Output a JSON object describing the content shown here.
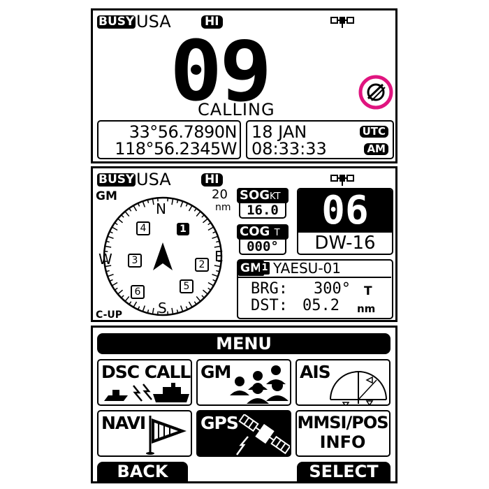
{
  "screen1": {
    "busy": "BUSY",
    "region": "USA",
    "power": "HI",
    "gps_icon": "gps-satellite-icon",
    "channel": "09",
    "status": "CALLING",
    "lat": "33°56.7890N",
    "lon": "118°56.2345W",
    "date": "18 JAN",
    "time": "08:33:33",
    "tz": "UTC",
    "ampm": "AM",
    "scramble_icon": "scramble-icon"
  },
  "screen2": {
    "busy": "BUSY",
    "region": "USA",
    "power": "HI",
    "mode": "GM",
    "range": "20",
    "range_unit": "nm",
    "orientation": "C-UP",
    "compass": {
      "n": "N",
      "s": "S",
      "e": "E",
      "w": "W"
    },
    "members": [
      "1",
      "2",
      "3",
      "4",
      "5",
      "6"
    ],
    "sog_label": "SOG",
    "sog_unit": "KT",
    "sog_value": "16.0",
    "cog_label": "COG",
    "cog_unit": "T",
    "cog_value": "000°",
    "channel": "06",
    "channel_name": "DW-16",
    "gm_label": "GM",
    "gm_index": "1",
    "vessel": "YAESU-01",
    "brg_label": "BRG:",
    "brg_value": "300°",
    "brg_unit": "T",
    "dst_label": "DST:",
    "dst_value": "05.2",
    "dst_unit": "nm"
  },
  "screen3": {
    "title": "MENU",
    "tiles": [
      {
        "label": "DSC CALL",
        "icon": "ships-icon"
      },
      {
        "label": "GM",
        "icon": "group-icon"
      },
      {
        "label": "AIS",
        "icon": "radar-icon"
      },
      {
        "label": "NAVI",
        "icon": "flag-icon"
      },
      {
        "label": "GPS",
        "icon": "satellite-icon"
      },
      {
        "label": "MMSI/POS",
        "label2": "INFO",
        "icon": ""
      }
    ],
    "back": "BACK",
    "select": "SELECT"
  },
  "colors": {
    "highlight": "#e0147f",
    "fg": "#000000",
    "bg": "#ffffff"
  }
}
